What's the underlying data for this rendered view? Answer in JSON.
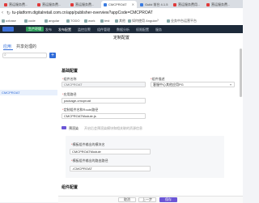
{
  "browser": {
    "tabs": [
      {
        "label": "营运服务费..."
      },
      {
        "label": "营运服务费..."
      },
      {
        "label": "营运服务费..."
      },
      {
        "label": "CMCPROAT"
      },
      {
        "label": "Guild 前台 4.1.5"
      },
      {
        "label": "营运服务费用..."
      },
      {
        "label": "营运服务费..."
      }
    ],
    "url": "tu-platform.digitalretail.com.cn/app/publisher-overview?appCode=CMCPROAT",
    "bookmarks": [
      "uxbase",
      "code",
      "angular",
      "TODO",
      "work",
      "test",
      "其他",
      "如何使用 Angular？",
      "业务中台运营平台"
    ]
  },
  "app": {
    "env_badge": "生产环境",
    "nav": [
      "发布",
      "发布配置",
      "监控告警",
      "组件管理",
      "数据分析",
      "权限配置",
      "服务"
    ]
  },
  "page": {
    "title": "定制配置"
  },
  "left_panel": {
    "tabs": [
      "应用",
      "共享处理的"
    ],
    "selected_item": "CMCPROAT"
  },
  "form": {
    "basic_section": "基础配置",
    "app_code_label": "组件名称",
    "app_code_value": "CMCPROAT",
    "type_label": "组件描述",
    "type_value": "客服中心其他应用PG",
    "package_label": "应用路径",
    "package_value": "package-cmcproat",
    "module_label": "定制组件名和Route路径",
    "module_value": "CMCPROATModule.js",
    "toggle_label": "预渲染",
    "toggle_hint": "开启后会预渲染模块和相关联的资源信息",
    "sub_name_label": "模板组件输出的模块名",
    "sub_name_value": "CMCPROATModule",
    "sub_path_label": "模板组件输出的路由路径",
    "sub_path_value": "./CMCPROAT",
    "advanced_section": "组件配置"
  },
  "footer": {
    "cancel": "取消",
    "prev": "上一步",
    "save": "保存"
  }
}
